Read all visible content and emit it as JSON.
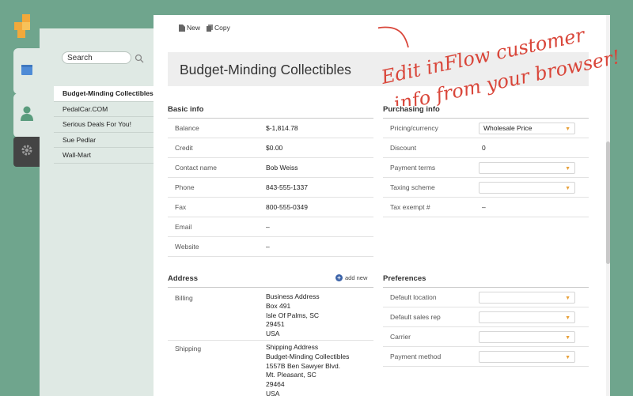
{
  "nav": {
    "icons": [
      "app-logo-icon",
      "items-icon",
      "customer-icon",
      "gear-icon"
    ]
  },
  "search": {
    "placeholder": "Search",
    "value": "Search"
  },
  "customers": [
    "Budget-Minding Collectibles",
    "PedalCar.COM",
    "Serious Deals For You!",
    "Sue Pedlar",
    "Wall-Mart"
  ],
  "selected_customer_index": 0,
  "toolbar": {
    "new_label": "New",
    "copy_label": "Copy"
  },
  "customer": {
    "name": "Budget-Minding Collectibles"
  },
  "basic_info": {
    "heading": "Basic info",
    "rows": [
      {
        "label": "Balance",
        "value": "$-1,814.78"
      },
      {
        "label": "Credit",
        "value": "$0.00"
      },
      {
        "label": "Contact name",
        "value": "Bob Weiss"
      },
      {
        "label": "Phone",
        "value": "843-555-1337"
      },
      {
        "label": "Fax",
        "value": "800-555-0349"
      },
      {
        "label": "Email",
        "value": "–"
      },
      {
        "label": "Website",
        "value": "–"
      }
    ]
  },
  "purchasing_info": {
    "heading": "Purchasing info",
    "rows": [
      {
        "label": "Pricing/currency",
        "value": "Wholesale Price",
        "type": "dropdown"
      },
      {
        "label": "Discount",
        "value": "0",
        "type": "text"
      },
      {
        "label": "Payment terms",
        "value": "",
        "type": "dropdown"
      },
      {
        "label": "Taxing scheme",
        "value": "",
        "type": "dropdown"
      },
      {
        "label": "Tax exempt #",
        "value": "–",
        "type": "text"
      }
    ]
  },
  "address": {
    "heading": "Address",
    "add_new_label": "add new",
    "billing": {
      "label": "Billing",
      "lines": [
        "Business Address",
        "Box 491",
        "Isle Of Palms, SC",
        "29451",
        "USA"
      ]
    },
    "shipping": {
      "label": "Shipping",
      "lines": [
        "Shipping Address",
        "Budget-Minding Collectibles",
        "1557B Ben Sawyer Blvd.",
        "Mt. Pleasant, SC",
        "29464",
        "USA"
      ]
    }
  },
  "preferences": {
    "heading": "Preferences",
    "rows": [
      {
        "label": "Default location",
        "value": ""
      },
      {
        "label": "Default sales rep",
        "value": ""
      },
      {
        "label": "Carrier",
        "value": ""
      },
      {
        "label": "Payment method",
        "value": ""
      }
    ]
  },
  "annotation": {
    "line1": "Edit inFlow customer",
    "line2": "info from your browser!"
  },
  "colors": {
    "background": "#6fa58d",
    "panel": "#dfe9e4",
    "annotation": "#d9463a",
    "logo_orange": "#f2a93b",
    "accent_blue": "#3c63a8"
  }
}
